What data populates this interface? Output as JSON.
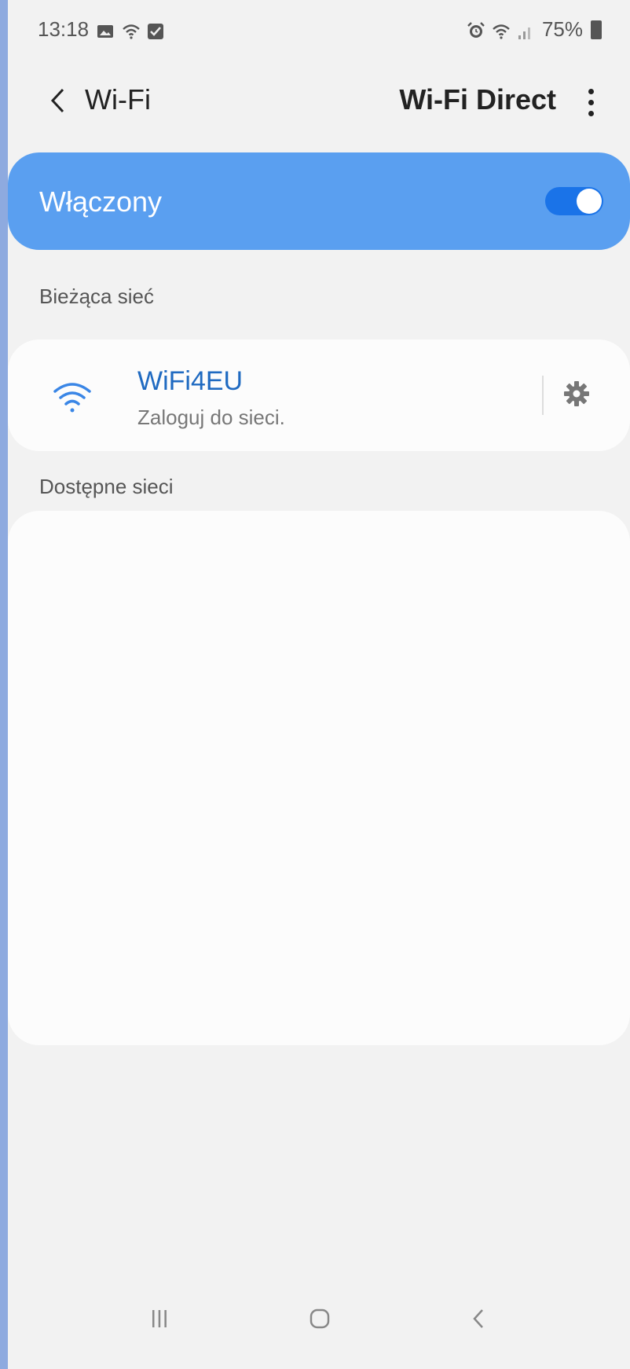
{
  "status_bar": {
    "time": "13:18",
    "battery": "75%",
    "left_icons": [
      "image-notification-icon",
      "wifi-status-icon",
      "check-notification-icon"
    ],
    "right_icons": [
      "alarm-icon",
      "wifi-signal-icon",
      "cell-signal-icon",
      "battery-icon"
    ]
  },
  "app_bar": {
    "title": "Wi-Fi",
    "wifi_direct_label": "Wi-Fi Direct"
  },
  "master_switch": {
    "label": "Włączony",
    "state": "on"
  },
  "current_network": {
    "section_label": "Bieżąca sieć",
    "name": "WiFi4EU",
    "status": "Zaloguj do sieci."
  },
  "available_networks": {
    "section_label": "Dostępne sieci",
    "items": []
  },
  "colors": {
    "accent": "#1a73e8",
    "switch_bar": "#5a9ff0",
    "network_name": "#1f6ac1",
    "background": "#f2f2f2",
    "frame": "#8eaadf"
  }
}
